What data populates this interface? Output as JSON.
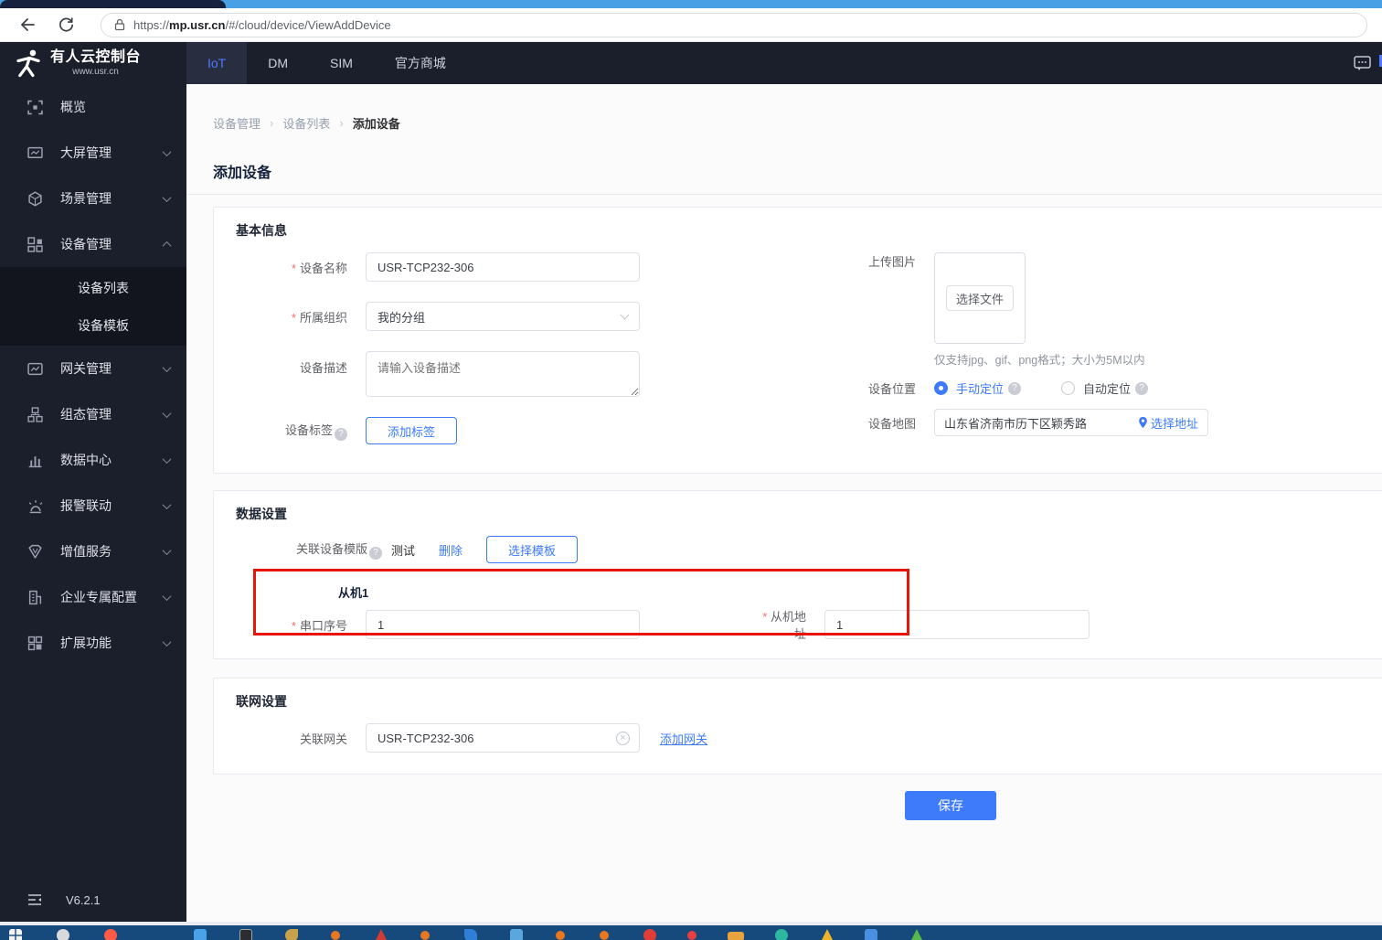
{
  "browser": {
    "url_scheme": "https://",
    "url_domain": "mp.usr.cn",
    "url_path": "/#/cloud/device/ViewAddDevice"
  },
  "header": {
    "brand_title": "有人云控制台",
    "brand_subtitle": "www.usr.cn",
    "nav": [
      {
        "label": "IoT",
        "active": true
      },
      {
        "label": "DM",
        "active": false
      },
      {
        "label": "SIM",
        "active": false
      },
      {
        "label": "官方商城",
        "active": false
      }
    ]
  },
  "sidebar": {
    "items": [
      {
        "label": "概览",
        "icon": "overview-icon"
      },
      {
        "label": "大屏管理",
        "icon": "big-screen-icon"
      },
      {
        "label": "场景管理",
        "icon": "scene-icon"
      },
      {
        "label": "设备管理",
        "icon": "device-icon",
        "expanded": true
      },
      {
        "label": "网关管理",
        "icon": "gateway-icon"
      },
      {
        "label": "组态管理",
        "icon": "scada-icon"
      },
      {
        "label": "数据中心",
        "icon": "data-center-icon"
      },
      {
        "label": "报警联动",
        "icon": "alarm-icon"
      },
      {
        "label": "增值服务",
        "icon": "vas-icon"
      },
      {
        "label": "企业专属配置",
        "icon": "enterprise-icon"
      },
      {
        "label": "扩展功能",
        "icon": "extension-icon"
      }
    ],
    "device_submenu": [
      "设备列表",
      "设备模板"
    ],
    "version": "V6.2.1"
  },
  "breadcrumb": [
    "设备管理",
    "设备列表",
    "添加设备"
  ],
  "page": {
    "title": "添加设备"
  },
  "basic": {
    "title": "基本信息",
    "name_label": "设备名称",
    "name_value": "USR-TCP232-306",
    "org_label": "所属组织",
    "org_value": "我的分组",
    "desc_label": "设备描述",
    "desc_placeholder": "请输入设备描述",
    "tag_label": "设备标签",
    "add_tag": "添加标签",
    "upload_label": "上传图片",
    "choose_file": "选择文件",
    "upload_hint": "仅支持jpg、gif、png格式；大小为5M以内",
    "location_label": "设备位置",
    "manual": "手动定位",
    "auto": "自动定位",
    "map_label": "设备地图",
    "map_value": "山东省济南市历下区颖秀路",
    "choose_address": "选择地址"
  },
  "data_settings": {
    "title": "数据设置",
    "template_label": "关联设备模版",
    "template_name": "测试",
    "delete_link": "删除",
    "choose_template": "选择模板",
    "slave_title": "从机1",
    "serial_label": "串口序号",
    "serial_value": "1",
    "addr_label": "从机地址",
    "addr_value": "1"
  },
  "network": {
    "title": "联网设置",
    "gateway_label": "关联网关",
    "gateway_value": "USR-TCP232-306",
    "add_gateway": "添加网关"
  },
  "save_label": "保存",
  "colors": {
    "accent": "#3d7bfa",
    "annotation_red": "#e8150b",
    "sidebar_bg": "#1b1e2b",
    "taskbar_bg": "#16497c"
  }
}
